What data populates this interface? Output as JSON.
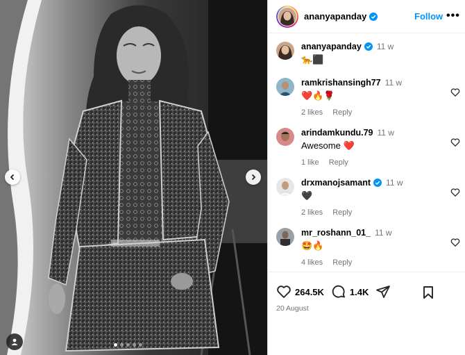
{
  "post": {
    "username": "ananyapanday",
    "follow_label": "Follow",
    "more_label": "•••",
    "caption_time": "11 w",
    "caption_text": "🐆⬛",
    "carousel_dots": 5,
    "carousel_active": 1
  },
  "comments": [
    {
      "username": "ramkrishansingh77",
      "time": "11 w",
      "text": "❤️🔥🌹",
      "likes": "2 likes",
      "reply": "Reply",
      "verified": false
    },
    {
      "username": "arindamkundu.79",
      "time": "11 w",
      "text": "Awesome ❤️",
      "likes": "1 like",
      "reply": "Reply",
      "verified": false
    },
    {
      "username": "drxmanojsamant",
      "time": "11 w",
      "text": "🖤",
      "likes": "2 likes",
      "reply": "Reply",
      "verified": true
    },
    {
      "username": "mr_roshann_01_",
      "time": "11 w",
      "text": "🤩🔥",
      "likes": "4 likes",
      "reply": "Reply",
      "verified": false
    }
  ],
  "actions": {
    "likes_count": "264.5K",
    "comments_count": "1.4K",
    "date": "20 August"
  },
  "colors": {
    "link_blue": "#0095f6",
    "verified_blue": "#0095f6",
    "muted": "#737373"
  }
}
